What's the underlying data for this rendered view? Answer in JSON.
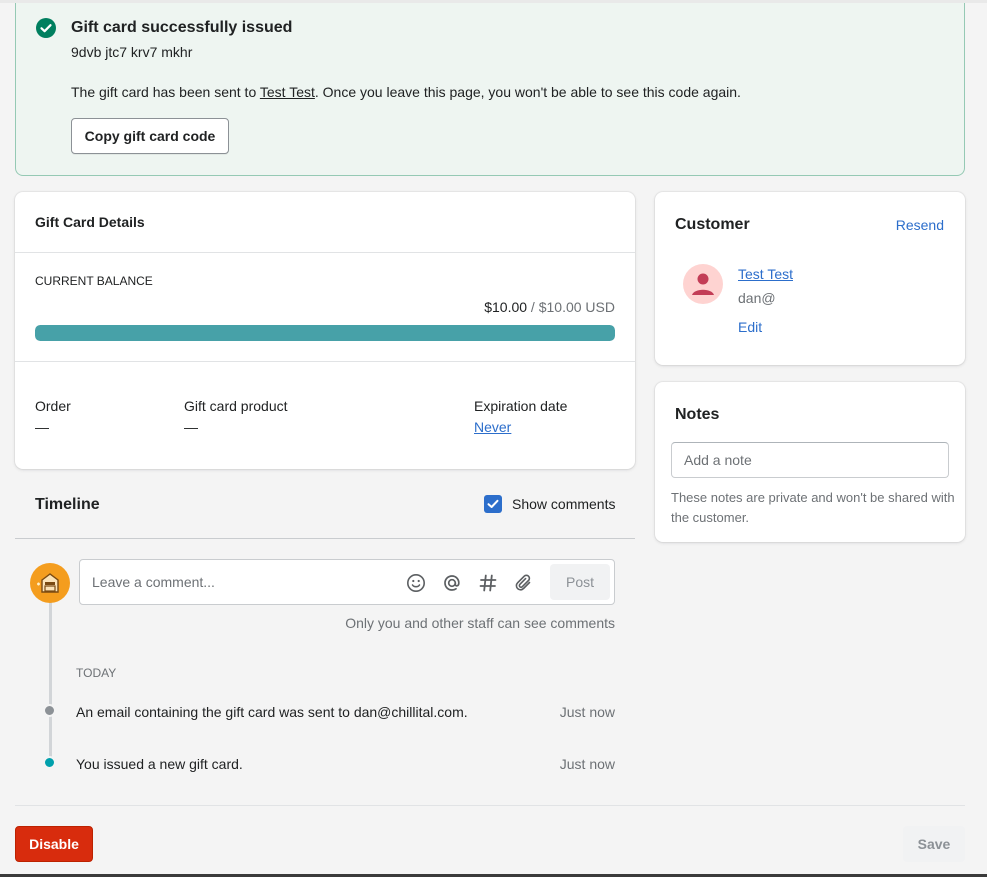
{
  "banner": {
    "title": "Gift card successfully issued",
    "code": "9dvb jtc7 krv7 mkhr",
    "message_before": "The gift card has been sent to ",
    "message_recipient": "Test Test",
    "message_after": ". Once you leave this page, you won't be able to see this code again.",
    "copy_button": "Copy gift card code"
  },
  "details": {
    "title": "Gift Card Details",
    "balance_label": "CURRENT BALANCE",
    "balance_current": "$10.00",
    "balance_separator": " / ",
    "balance_total": "$10.00 USD",
    "balance_fraction": 1.0,
    "order_label": "Order",
    "order_value": "—",
    "product_label": "Gift card product",
    "product_value": "—",
    "expiration_label": "Expiration date",
    "expiration_value": "Never"
  },
  "customer": {
    "title": "Customer",
    "resend": "Resend",
    "name": "Test Test",
    "email": "dan@",
    "edit": "Edit"
  },
  "notes": {
    "title": "Notes",
    "placeholder": "Add a note",
    "help": "These notes are private and won't be shared with the customer."
  },
  "timeline": {
    "title": "Timeline",
    "show_comments_label": "Show comments",
    "show_comments_checked": true,
    "comment_placeholder": "Leave a comment...",
    "post_button": "Post",
    "staff_note": "Only you and other staff can see comments",
    "day_label": "TODAY",
    "events": [
      {
        "text": "An email containing the gift card was sent to dan@chillital.com.",
        "time": "Just now",
        "dot_color": "#8c9196"
      },
      {
        "text": "You issued a new gift card.",
        "time": "Just now",
        "dot_color": "#00a0ac"
      }
    ]
  },
  "footer": {
    "disable_button": "Disable",
    "save_button": "Save"
  },
  "colors": {
    "accent": "#2c6ecb",
    "success": "#007f5f",
    "progress": "#47a1a8",
    "critical": "#d82c0d"
  }
}
